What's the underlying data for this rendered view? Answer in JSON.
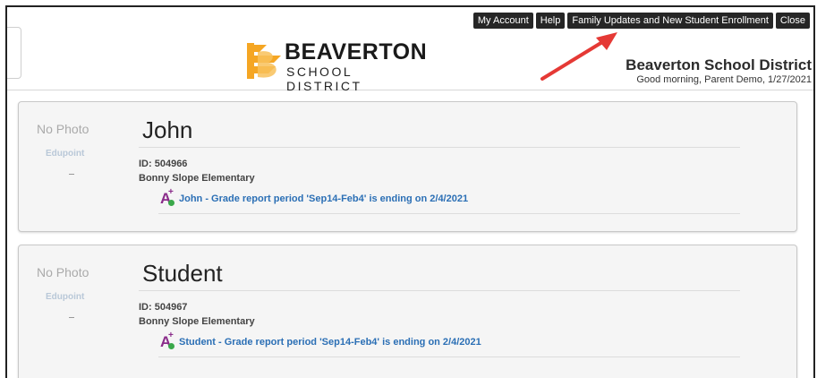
{
  "nav": {
    "buttons": [
      "My Account",
      "Help",
      "Family Updates and New Student Enrollment",
      "Close"
    ]
  },
  "logo": {
    "line1": "BEAVERTON",
    "line2": "SCHOOL DISTRICT"
  },
  "district": {
    "title": "Beaverton School District",
    "greeting": "Good morning, Parent Demo, 1/27/2021"
  },
  "students": [
    {
      "no_photo": "No Photo",
      "edupoint": "Edupoint",
      "name": "John",
      "id": "ID: 504966",
      "school": "Bonny Slope Elementary",
      "alert": "John - Grade report period 'Sep14-Feb4' is ending on 2/4/2021"
    },
    {
      "no_photo": "No Photo",
      "edupoint": "Edupoint",
      "name": "Student",
      "id": "ID: 504967",
      "school": "Bonny Slope Elementary",
      "alert": "Student - Grade report period 'Sep14-Feb4' is ending on 2/4/2021"
    }
  ],
  "colors": {
    "nav_button_bg": "#262626",
    "link": "#2b6fb5",
    "logo_orange": "#f5a623",
    "arrow": "#e53935",
    "grade_icon": "#8a2b8a",
    "grade_badge": "#3aa84a"
  },
  "icons": [
    "beaverton-logo-icon",
    "grade-report-icon",
    "red-arrow-annotation"
  ]
}
